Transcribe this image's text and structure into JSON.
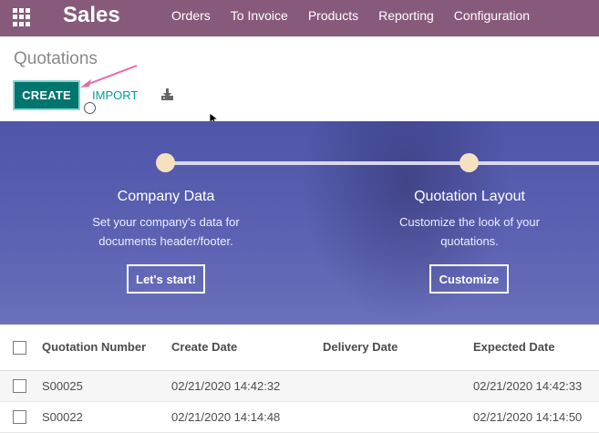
{
  "navbar": {
    "app_title": "Sales",
    "menu": [
      "Orders",
      "To Invoice",
      "Products",
      "Reporting",
      "Configuration"
    ],
    "bg_color": "#875a7b"
  },
  "control_panel": {
    "breadcrumb": "Quotations",
    "create_label": "CREATE",
    "import_label": "IMPORT",
    "download_icon": "download-icon",
    "accent_color": "#00756e"
  },
  "onboarding": {
    "steps": [
      {
        "title": "Company Data",
        "desc_line1": "Set your company's data for",
        "desc_line2": "documents header/footer.",
        "button": "Let's start!"
      },
      {
        "title": "Quotation Layout",
        "desc_line1": "Customize the look of your",
        "desc_line2": "quotations.",
        "button": "Customize"
      }
    ]
  },
  "table": {
    "columns": [
      "Quotation Number",
      "Create Date",
      "Delivery Date",
      "Expected Date"
    ],
    "rows": [
      {
        "number": "S00025",
        "create_date": "02/21/2020 14:42:32",
        "delivery_date": "",
        "expected_date": "02/21/2020 14:42:33"
      },
      {
        "number": "S00022",
        "create_date": "02/21/2020 14:14:48",
        "delivery_date": "",
        "expected_date": "02/21/2020 14:14:50"
      }
    ]
  }
}
